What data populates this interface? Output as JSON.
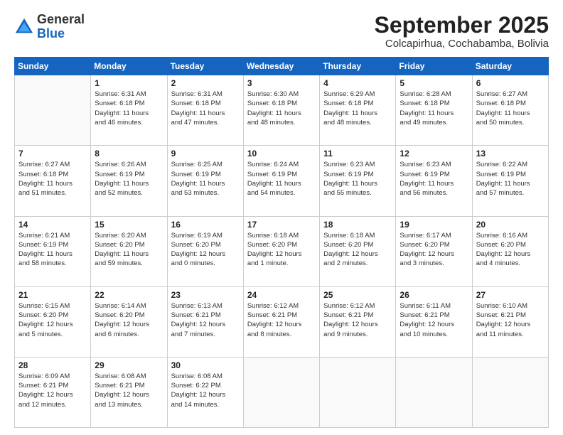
{
  "header": {
    "logo": {
      "general": "General",
      "blue": "Blue"
    },
    "title": "September 2025",
    "location": "Colcapirhua, Cochabamba, Bolivia"
  },
  "calendar": {
    "days_of_week": [
      "Sunday",
      "Monday",
      "Tuesday",
      "Wednesday",
      "Thursday",
      "Friday",
      "Saturday"
    ],
    "weeks": [
      [
        {
          "day": "",
          "info": ""
        },
        {
          "day": "1",
          "info": "Sunrise: 6:31 AM\nSunset: 6:18 PM\nDaylight: 11 hours\nand 46 minutes."
        },
        {
          "day": "2",
          "info": "Sunrise: 6:31 AM\nSunset: 6:18 PM\nDaylight: 11 hours\nand 47 minutes."
        },
        {
          "day": "3",
          "info": "Sunrise: 6:30 AM\nSunset: 6:18 PM\nDaylight: 11 hours\nand 48 minutes."
        },
        {
          "day": "4",
          "info": "Sunrise: 6:29 AM\nSunset: 6:18 PM\nDaylight: 11 hours\nand 48 minutes."
        },
        {
          "day": "5",
          "info": "Sunrise: 6:28 AM\nSunset: 6:18 PM\nDaylight: 11 hours\nand 49 minutes."
        },
        {
          "day": "6",
          "info": "Sunrise: 6:27 AM\nSunset: 6:18 PM\nDaylight: 11 hours\nand 50 minutes."
        }
      ],
      [
        {
          "day": "7",
          "info": "Sunrise: 6:27 AM\nSunset: 6:18 PM\nDaylight: 11 hours\nand 51 minutes."
        },
        {
          "day": "8",
          "info": "Sunrise: 6:26 AM\nSunset: 6:19 PM\nDaylight: 11 hours\nand 52 minutes."
        },
        {
          "day": "9",
          "info": "Sunrise: 6:25 AM\nSunset: 6:19 PM\nDaylight: 11 hours\nand 53 minutes."
        },
        {
          "day": "10",
          "info": "Sunrise: 6:24 AM\nSunset: 6:19 PM\nDaylight: 11 hours\nand 54 minutes."
        },
        {
          "day": "11",
          "info": "Sunrise: 6:23 AM\nSunset: 6:19 PM\nDaylight: 11 hours\nand 55 minutes."
        },
        {
          "day": "12",
          "info": "Sunrise: 6:23 AM\nSunset: 6:19 PM\nDaylight: 11 hours\nand 56 minutes."
        },
        {
          "day": "13",
          "info": "Sunrise: 6:22 AM\nSunset: 6:19 PM\nDaylight: 11 hours\nand 57 minutes."
        }
      ],
      [
        {
          "day": "14",
          "info": "Sunrise: 6:21 AM\nSunset: 6:19 PM\nDaylight: 11 hours\nand 58 minutes."
        },
        {
          "day": "15",
          "info": "Sunrise: 6:20 AM\nSunset: 6:20 PM\nDaylight: 11 hours\nand 59 minutes."
        },
        {
          "day": "16",
          "info": "Sunrise: 6:19 AM\nSunset: 6:20 PM\nDaylight: 12 hours\nand 0 minutes."
        },
        {
          "day": "17",
          "info": "Sunrise: 6:18 AM\nSunset: 6:20 PM\nDaylight: 12 hours\nand 1 minute."
        },
        {
          "day": "18",
          "info": "Sunrise: 6:18 AM\nSunset: 6:20 PM\nDaylight: 12 hours\nand 2 minutes."
        },
        {
          "day": "19",
          "info": "Sunrise: 6:17 AM\nSunset: 6:20 PM\nDaylight: 12 hours\nand 3 minutes."
        },
        {
          "day": "20",
          "info": "Sunrise: 6:16 AM\nSunset: 6:20 PM\nDaylight: 12 hours\nand 4 minutes."
        }
      ],
      [
        {
          "day": "21",
          "info": "Sunrise: 6:15 AM\nSunset: 6:20 PM\nDaylight: 12 hours\nand 5 minutes."
        },
        {
          "day": "22",
          "info": "Sunrise: 6:14 AM\nSunset: 6:20 PM\nDaylight: 12 hours\nand 6 minutes."
        },
        {
          "day": "23",
          "info": "Sunrise: 6:13 AM\nSunset: 6:21 PM\nDaylight: 12 hours\nand 7 minutes."
        },
        {
          "day": "24",
          "info": "Sunrise: 6:12 AM\nSunset: 6:21 PM\nDaylight: 12 hours\nand 8 minutes."
        },
        {
          "day": "25",
          "info": "Sunrise: 6:12 AM\nSunset: 6:21 PM\nDaylight: 12 hours\nand 9 minutes."
        },
        {
          "day": "26",
          "info": "Sunrise: 6:11 AM\nSunset: 6:21 PM\nDaylight: 12 hours\nand 10 minutes."
        },
        {
          "day": "27",
          "info": "Sunrise: 6:10 AM\nSunset: 6:21 PM\nDaylight: 12 hours\nand 11 minutes."
        }
      ],
      [
        {
          "day": "28",
          "info": "Sunrise: 6:09 AM\nSunset: 6:21 PM\nDaylight: 12 hours\nand 12 minutes."
        },
        {
          "day": "29",
          "info": "Sunrise: 6:08 AM\nSunset: 6:21 PM\nDaylight: 12 hours\nand 13 minutes."
        },
        {
          "day": "30",
          "info": "Sunrise: 6:08 AM\nSunset: 6:22 PM\nDaylight: 12 hours\nand 14 minutes."
        },
        {
          "day": "",
          "info": ""
        },
        {
          "day": "",
          "info": ""
        },
        {
          "day": "",
          "info": ""
        },
        {
          "day": "",
          "info": ""
        }
      ]
    ]
  }
}
